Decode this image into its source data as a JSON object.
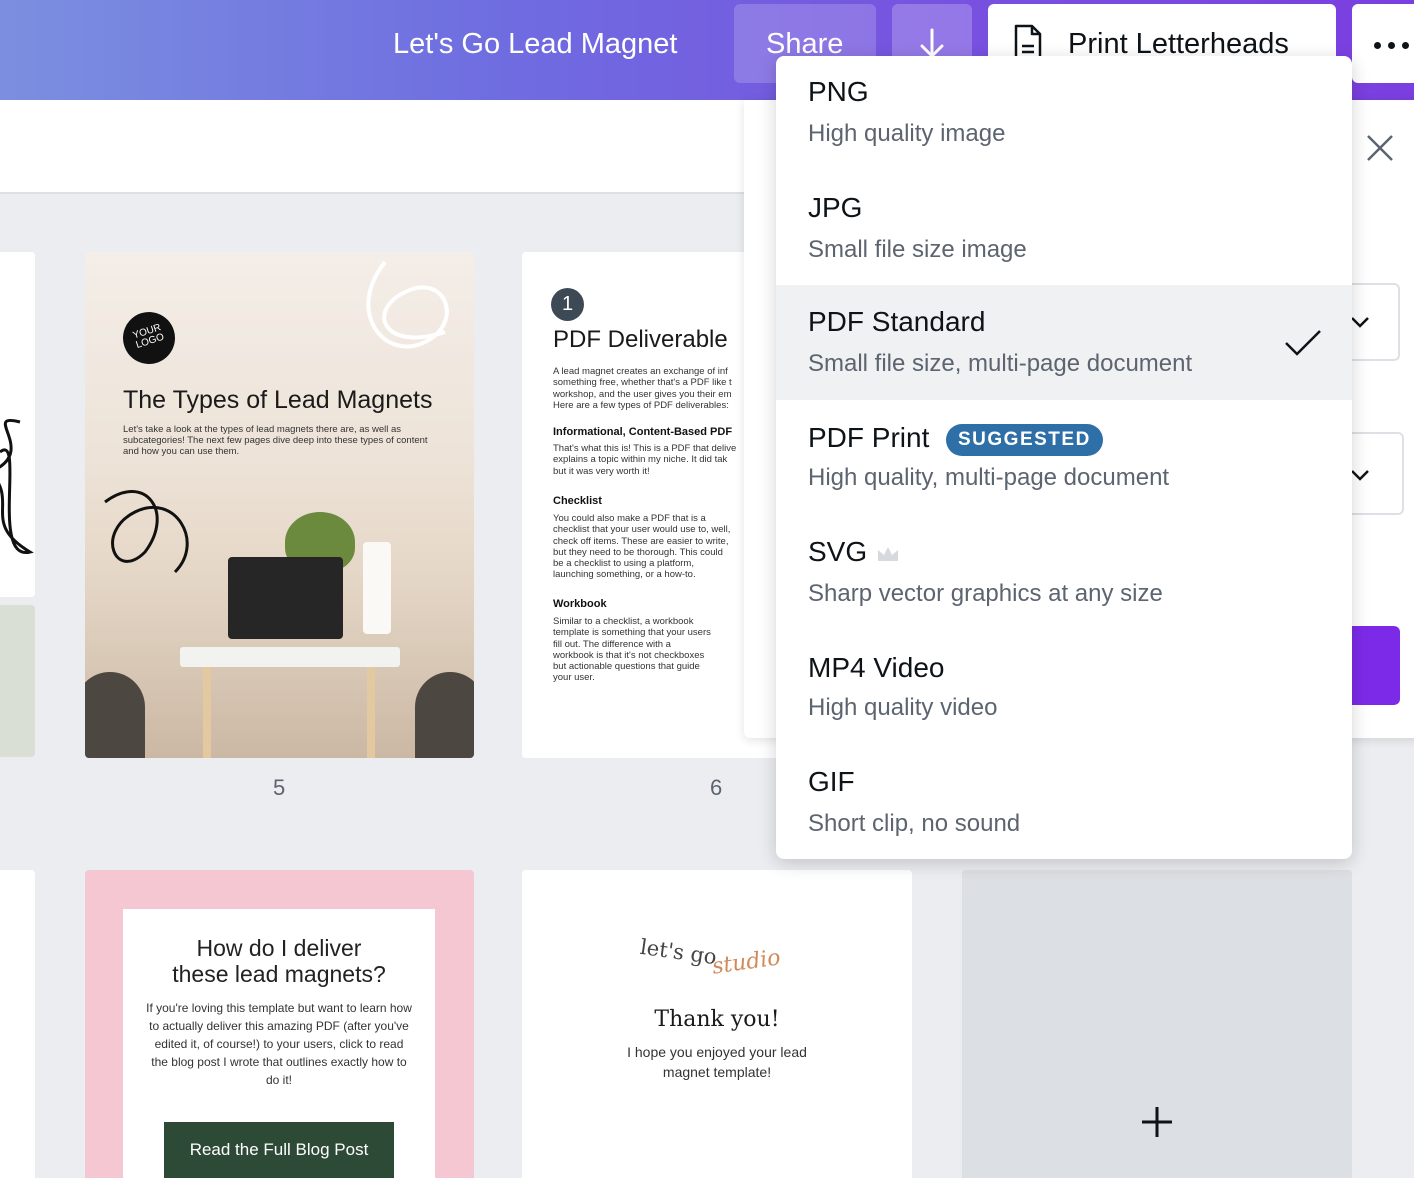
{
  "header": {
    "doc_title": "Let's Go Lead Magnet",
    "share_label": "Share",
    "print_label": "Print Letterheads"
  },
  "pages": {
    "p5": {
      "logo": "YOUR LOGO",
      "title": "The Types of Lead Magnets",
      "body": "Let's take a look at the types of lead magnets there are, as well as subcategories! The next few pages dive deep into these types of content and how you can use them.",
      "number": "5"
    },
    "p6": {
      "badge": "1",
      "title": "PDF Deliverable",
      "intro": "A lead magnet creates an exchange of inf\nsomething free, whether that's a PDF like t\nworkshop, and the user gives you their em\nHere are a few types of PDF deliverables:",
      "h1": "Informational, Content-Based PDF",
      "t1": "That's what this is! This is a PDF that delive\nexplains a topic within my niche. It did tak\nbut it was very worth it!",
      "h2": "Checklist",
      "t2": "You could also make a PDF that is a\nchecklist that your user would use to, well,\ncheck off items. These are easier to write,\nbut they need to be thorough. This could\nbe a checklist to using a platform,\nlaunching something, or a how-to.",
      "h3": "Workbook",
      "t3": "Similar to a checklist, a workbook\ntemplate is something that your users\nfill out. The difference with a\nworkbook is that it's not checkboxes\nbut actionable questions that guide\nyour user.",
      "number": "6"
    },
    "pink": {
      "title": "How do I deliver\nthese lead magnets?",
      "body": "If you're loving this template but want to learn how to actually deliver this amazing PDF (after you've edited it, of course!) to your users, click to read the blog post I wrote that outlines exactly how to do it!",
      "cta": "Read the Full Blog Post"
    },
    "thanks": {
      "logo_a": "let's go",
      "logo_b": "studio",
      "title": "Thank you!",
      "sub": "I hope you enjoyed your lead magnet template!"
    }
  },
  "download_menu": {
    "selected": "PDF Standard",
    "options": [
      {
        "name": "PNG",
        "desc": "High quality image"
      },
      {
        "name": "JPG",
        "desc": "Small file size image"
      },
      {
        "name": "PDF Standard",
        "desc": "Small file size, multi-page document"
      },
      {
        "name": "PDF Print",
        "desc": "High quality, multi-page document",
        "badge": "SUGGESTED"
      },
      {
        "name": "SVG",
        "desc": "Sharp vector graphics at any size"
      },
      {
        "name": "MP4 Video",
        "desc": "High quality video"
      },
      {
        "name": "GIF",
        "desc": "Short clip, no sound"
      }
    ]
  },
  "icons": [
    "download-icon",
    "document-icon",
    "more-icon",
    "close-icon",
    "chevron-down-icon",
    "check-icon",
    "crown-icon",
    "plus-icon"
  ],
  "colors": {
    "brand_purple": "#7d2ae8",
    "badge_blue": "#2f6fa8",
    "selected_bg": "#f0f1f3"
  }
}
